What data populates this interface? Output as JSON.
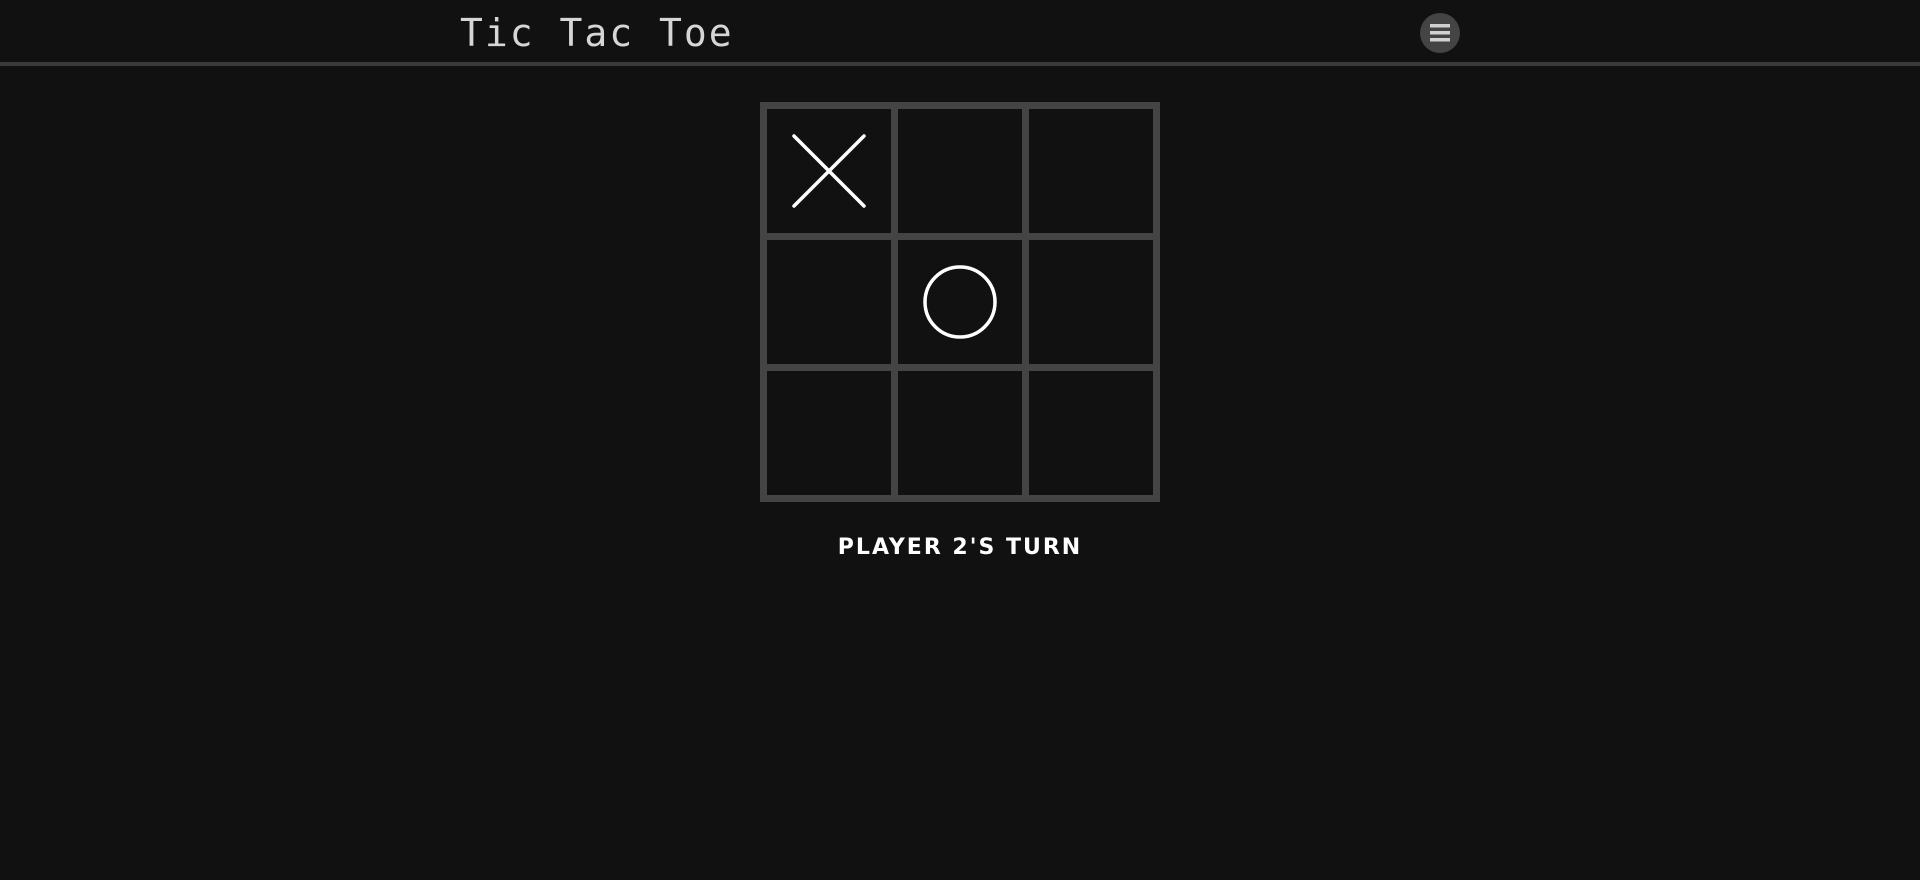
{
  "header": {
    "title": "Tic Tac Toe",
    "menu_icon": "hamburger-menu-icon"
  },
  "board": {
    "cells": [
      "X",
      "",
      "",
      "",
      "O",
      "",
      "",
      "",
      ""
    ]
  },
  "status": {
    "text": "PLAYER 2'S TURN"
  },
  "colors": {
    "background": "#111111",
    "grid": "#444444",
    "title": "#d6d6d6",
    "marks": "#ffffff",
    "header_border": "#3a3a3a"
  }
}
